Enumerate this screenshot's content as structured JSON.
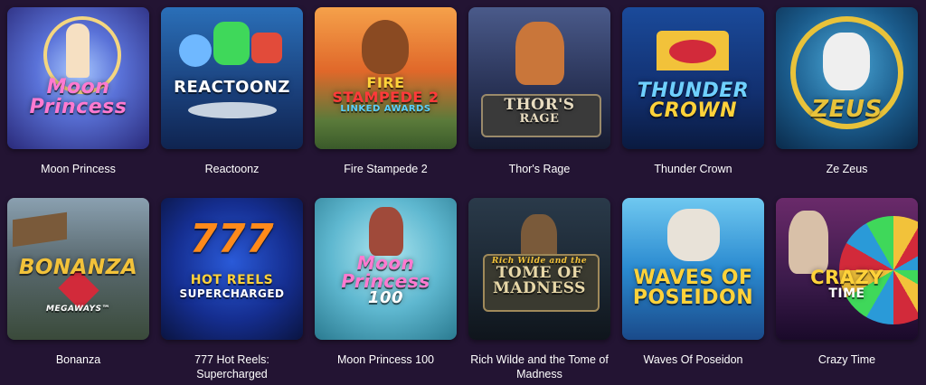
{
  "games": [
    {
      "title": "Moon Princess",
      "logo": [
        "Moon",
        "Princess"
      ]
    },
    {
      "title": "Reactoonz",
      "logo": [
        "REACTOONZ"
      ]
    },
    {
      "title": "Fire Stampede 2",
      "logo": [
        "FIRE",
        "STAMPEDE 2",
        "LINKED AWARDS"
      ]
    },
    {
      "title": "Thor's Rage",
      "logo": [
        "THOR'S",
        "RAGE"
      ]
    },
    {
      "title": "Thunder Crown",
      "logo": [
        "THUNDER",
        "CROWN"
      ]
    },
    {
      "title": "Ze Zeus",
      "logo": [
        "ZEUS"
      ]
    },
    {
      "title": "Bonanza",
      "logo": [
        "BONANZA",
        "MEGAWAYS™"
      ]
    },
    {
      "title": "777 Hot Reels: Supercharged",
      "logo": [
        "777",
        "HOT REELS",
        "SUPERCHARGED"
      ]
    },
    {
      "title": "Moon Princess 100",
      "logo": [
        "Moon",
        "Princess",
        "100"
      ]
    },
    {
      "title": "Rich Wilde and the Tome of Madness",
      "logo": [
        "Rich Wilde and the",
        "TOME OF",
        "MADNESS"
      ]
    },
    {
      "title": "Waves Of Poseidon",
      "logo": [
        "WAVES OF",
        "POSEIDON"
      ]
    },
    {
      "title": "Crazy Time",
      "logo": [
        "CRAZY",
        "TIME"
      ]
    }
  ],
  "colors": {
    "background": "#231433",
    "caption": "#ffffff"
  }
}
